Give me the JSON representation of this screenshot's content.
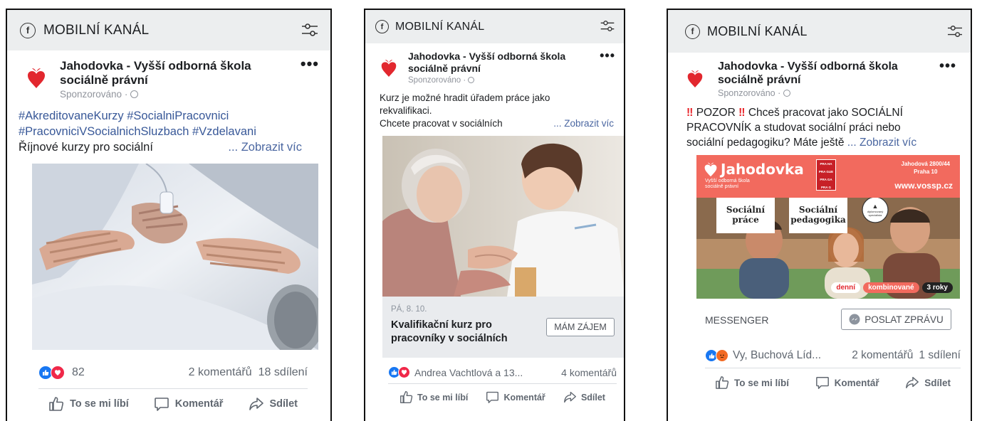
{
  "common": {
    "channel_title": "MOBILNÍ KANÁL",
    "fb_glyph": "f",
    "page_name": "Jahodovka - Vyšší odborná škola sociálně právní",
    "sponsored": "Sponzorováno · ",
    "more": "•••",
    "like_label": "To se mi líbí",
    "comment_label": "Komentář",
    "share_label": "Sdílet",
    "icons": [
      "facebook-icon",
      "filter-settings-icon",
      "heart-logo-icon",
      "globe-icon",
      "more-icon",
      "like-reaction-icon",
      "love-reaction-icon",
      "angry-reaction-icon",
      "thumbs-up-icon",
      "comment-icon",
      "share-icon",
      "messenger-icon"
    ],
    "colors": {
      "header_bg": "#eceeef",
      "link": "#4b67a1",
      "hashtag": "#385898",
      "brand_red": "#e2272e",
      "like_blue": "#1877f2",
      "love_red": "#f02849",
      "banner_coral": "#f26a5e",
      "cta_bg": "#e9ebee"
    }
  },
  "posts": [
    {
      "hashtags_line1": "#AkreditovaneKurzy #SocialniPracovnici",
      "hashtags_line2": "#PracovniciVSocialnichSluzbach #Vzdelavani",
      "text_line": "Říjnové kurzy pro sociální",
      "see_more": "... Zobrazit víc",
      "reaction_count": "82",
      "comments": "2 komentářů",
      "shares": "18 sdílení"
    },
    {
      "text_line1": "Kurz je možné hradit úřadem práce jako",
      "text_line2": "rekvalifikaci.",
      "text_line3": "Chcete pracovat v sociálních",
      "see_more": "... Zobrazit víc",
      "event_date": "PÁ, 8. 10.",
      "cta_title": "Kvalifikační kurz pro pracovníky v sociálních",
      "cta_button": "MÁM ZÁJEM",
      "reaction_names": "Andrea Vachtlová a 13...",
      "comments": "4 komentářů"
    },
    {
      "alert_mark": "‼",
      "text_line1": "POZOR",
      "text_line1_rest": "Chceš pracovat jako SOCIÁLNÍ",
      "text_line2": "PRACOVNÍK a studovat sociální práci nebo",
      "text_line3": "sociální pedagogiku? Máte ještě",
      "see_more": "... Zobrazit víc",
      "banner": {
        "brand": "Jahodovka",
        "brand_sub1": "Vyšší odborná škola",
        "brand_sub2": "sociálně právní",
        "praha_lines": [
          "PRA HA",
          "PRA GUE",
          "PRA GA",
          "PRA G"
        ],
        "address1": "Jahodová 2800/44",
        "address2": "Praha 10",
        "website": "www.vossp.cz",
        "label1_l1": "Sociální",
        "label1_l2": "práce",
        "label2_l1": "Sociální",
        "label2_l2": "pedagogika",
        "badge_l1": "diplomovaný",
        "badge_l2": "specialista",
        "pill1": "denní",
        "pill2": "kombinované",
        "pill3": "3 roky"
      },
      "messenger_label": "MESSENGER",
      "cta_button": "POSLAT ZPRÁVU",
      "reaction_names": "Vy, Buchová Líd...",
      "comments": "2 komentářů",
      "shares": "1 sdílení"
    }
  ]
}
